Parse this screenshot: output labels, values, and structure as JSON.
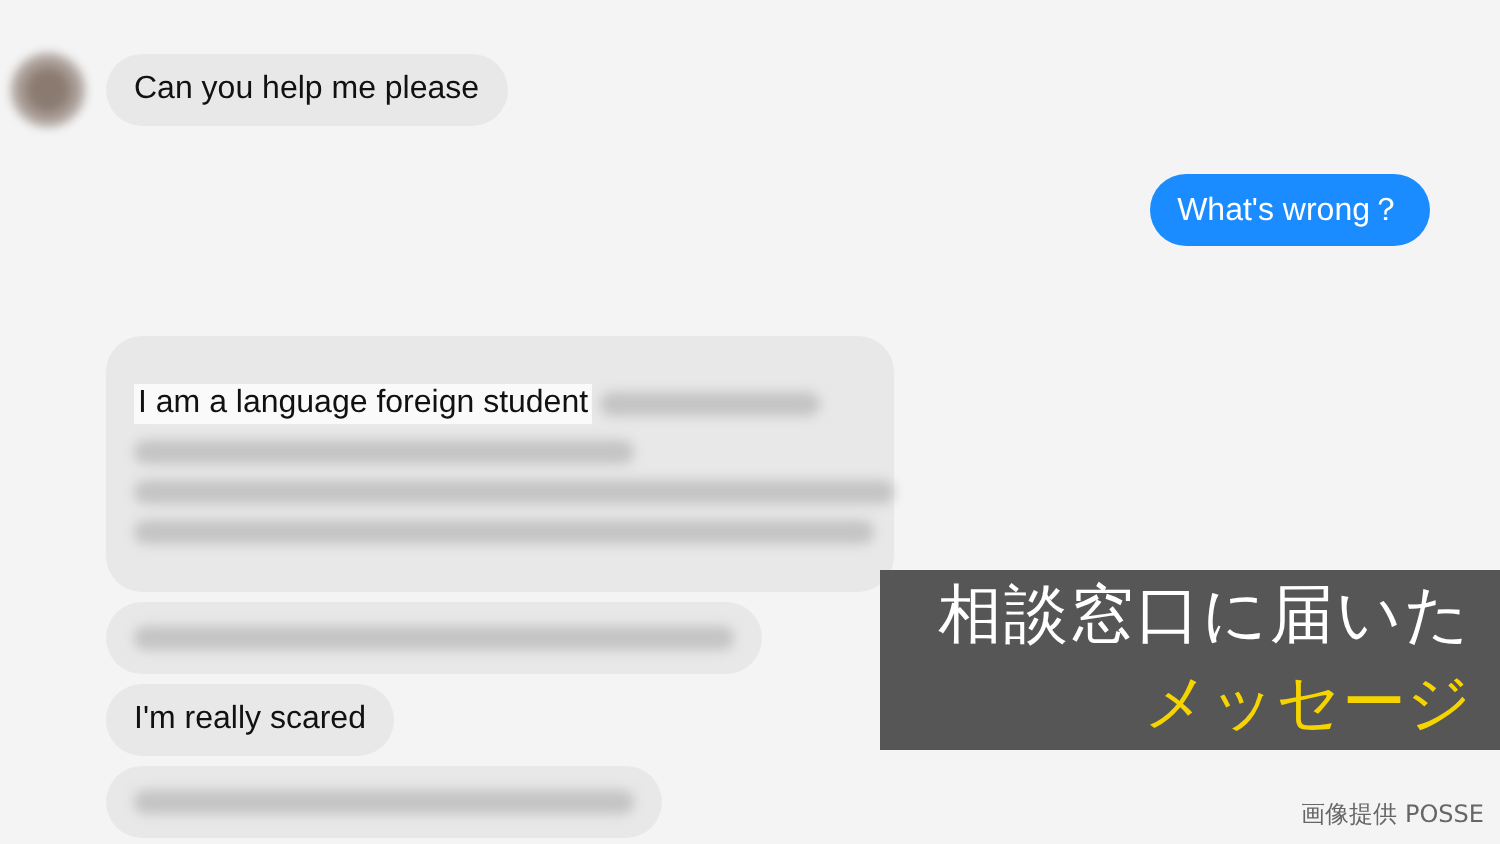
{
  "messages": [
    {
      "kind": "received",
      "avatar": true,
      "text": "Can you help me please"
    },
    {
      "kind": "sent",
      "text": "What's wrong？"
    },
    {
      "kind": "received_partly_blurred",
      "text": "I am a language foreign student"
    },
    {
      "kind": "blurred"
    },
    {
      "kind": "received",
      "text": "I'm really scared"
    },
    {
      "kind": "blurred_short"
    }
  ],
  "caption": {
    "line_1": "相談窓口に届いた",
    "line_2": "メッセージ"
  },
  "credit": "画像提供 POSSE"
}
